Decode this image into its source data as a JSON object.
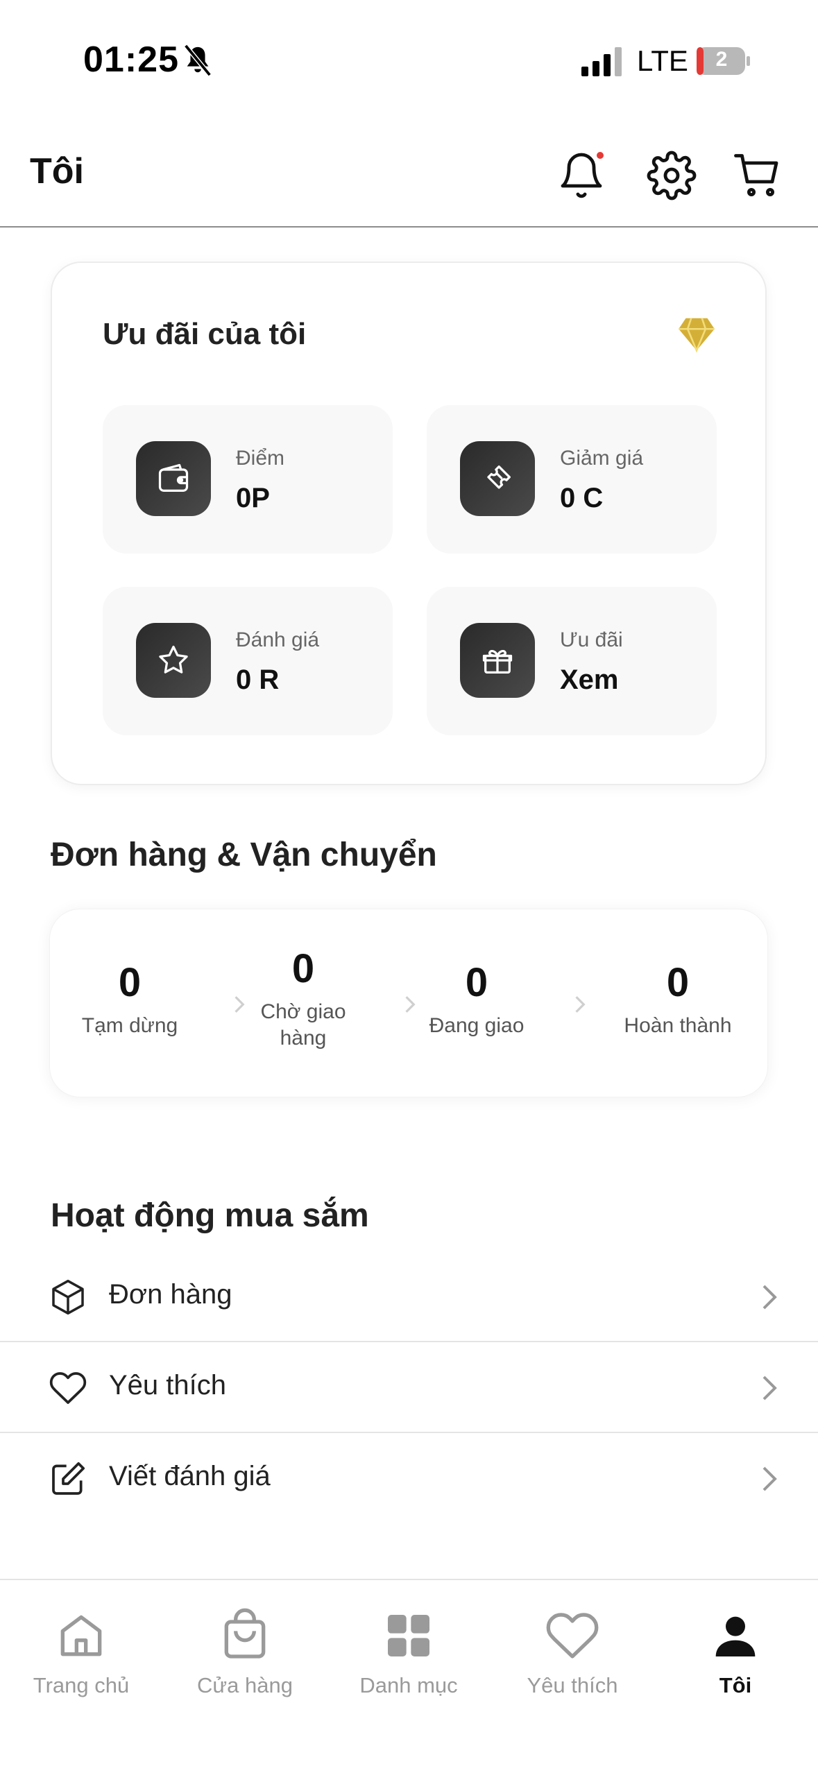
{
  "status_bar": {
    "time": "01:25",
    "network": "LTE",
    "battery": "2"
  },
  "header": {
    "title": "Tôi"
  },
  "offers": {
    "title": "Ưu đãi của tôi",
    "tiles": [
      {
        "label": "Điểm",
        "value": "0P",
        "icon": "wallet-icon"
      },
      {
        "label": "Giảm giá",
        "value": "0 C",
        "icon": "ticket-icon"
      },
      {
        "label": "Đánh giá",
        "value": "0 R",
        "icon": "star-icon"
      },
      {
        "label": "Ưu đãi",
        "value": "Xem",
        "icon": "gift-icon"
      }
    ]
  },
  "orders": {
    "title": "Đơn hàng & Vận chuyển",
    "statuses": [
      {
        "count": "0",
        "label": "Tạm dừng"
      },
      {
        "count": "0",
        "label": "Chờ giao hàng"
      },
      {
        "count": "0",
        "label": "Đang giao"
      },
      {
        "count": "0",
        "label": "Hoàn thành"
      }
    ]
  },
  "activity": {
    "title": "Hoạt động mua sắm",
    "items": [
      {
        "label": "Đơn hàng",
        "icon": "box-icon"
      },
      {
        "label": "Yêu thích",
        "icon": "heart-icon"
      },
      {
        "label": "Viết đánh giá",
        "icon": "edit-icon"
      }
    ]
  },
  "nav": {
    "items": [
      {
        "label": "Trang chủ",
        "icon": "home-icon"
      },
      {
        "label": "Cửa hàng",
        "icon": "bag-icon"
      },
      {
        "label": "Danh mục",
        "icon": "grid-icon"
      },
      {
        "label": "Yêu thích",
        "icon": "heart-icon"
      },
      {
        "label": "Tôi",
        "icon": "user-icon",
        "active": true
      }
    ]
  },
  "colors": {
    "accent_gold": "#D4AF37",
    "notification_dot": "#E53935",
    "tile_icon_bg": "#333333"
  }
}
